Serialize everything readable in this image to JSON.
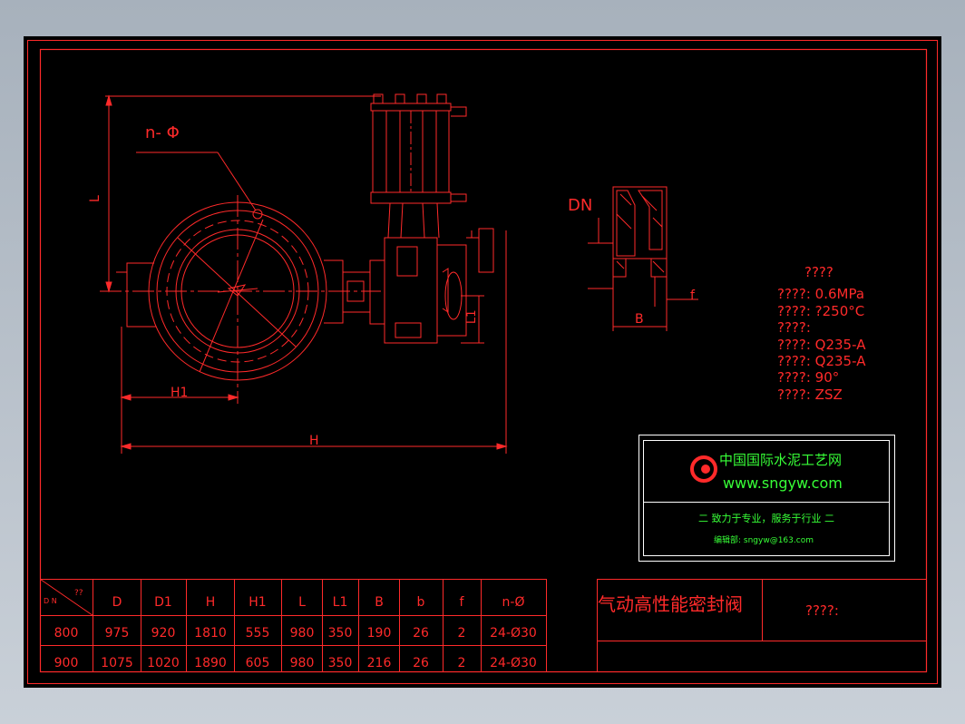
{
  "drawing": {
    "title_cn": "气动高性能密封阀",
    "title_field": "????:"
  },
  "dimension_labels": {
    "n_phi": "n- Φ",
    "L": "L",
    "H1": "H1",
    "H": "H",
    "L1": "L1",
    "DN": "DN",
    "B": "B",
    "f": "f"
  },
  "specs": {
    "heading": "????",
    "lines": [
      "????: 0.6MPa",
      "????: ?250°C",
      "????:",
      "????: Q235-A",
      "????: Q235-A",
      "????: 90°",
      "????: ZSZ"
    ]
  },
  "logo": {
    "company": "中国国际水泥工艺网",
    "url": "www.sngyw.com",
    "slogan": "二  致力于专业，服务于行业  二",
    "email": "编辑部: sngyw@163.com"
  },
  "table": {
    "corner_top": "??",
    "corner_bottom": "D N",
    "headers": [
      "D",
      "D1",
      "H",
      "H1",
      "L",
      "L1",
      "B",
      "b",
      "f",
      "n-Ø"
    ],
    "rows": [
      [
        "800",
        "975",
        "920",
        "1810",
        "555",
        "980",
        "350",
        "190",
        "26",
        "2",
        "24-Ø30"
      ],
      [
        "900",
        "1075",
        "1020",
        "1890",
        "605",
        "980",
        "350",
        "216",
        "26",
        "2",
        "24-Ø30"
      ]
    ]
  },
  "colors": {
    "background": "#000000",
    "lines": "#ff2a2a",
    "logo_text": "#37ff37",
    "frame": "#ffffff"
  }
}
